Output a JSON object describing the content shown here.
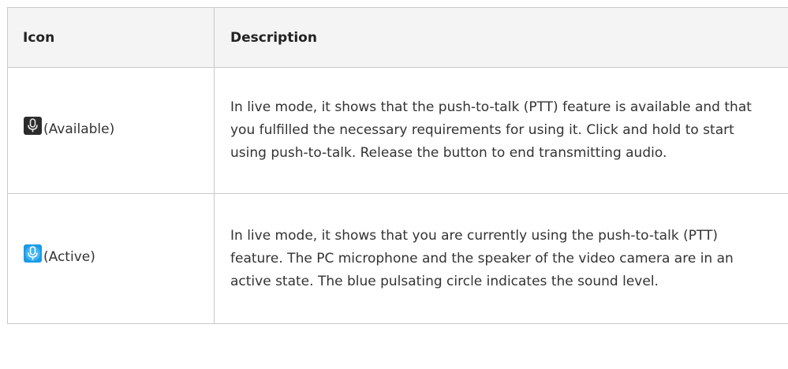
{
  "table": {
    "headers": {
      "icon": "Icon",
      "description": "Description"
    },
    "rows": [
      {
        "icon": "microphone-icon",
        "icon_color": "#2b2b2b",
        "icon_label": "(Available)",
        "description": "In live mode, it shows that the push-to-talk (PTT) feature is available and that you fulfilled the necessary requirements for using it. Click and hold to start using push-to-talk. Release the button to end transmitting audio."
      },
      {
        "icon": "microphone-icon",
        "icon_color": "#1a9be6",
        "icon_label": "(Active)",
        "description": "In live mode, it shows that you are currently using the push-to-talk (PTT) feature. The PC microphone and the speaker of the video camera are in an active state. The blue pulsating circle indicates the sound level."
      }
    ]
  }
}
